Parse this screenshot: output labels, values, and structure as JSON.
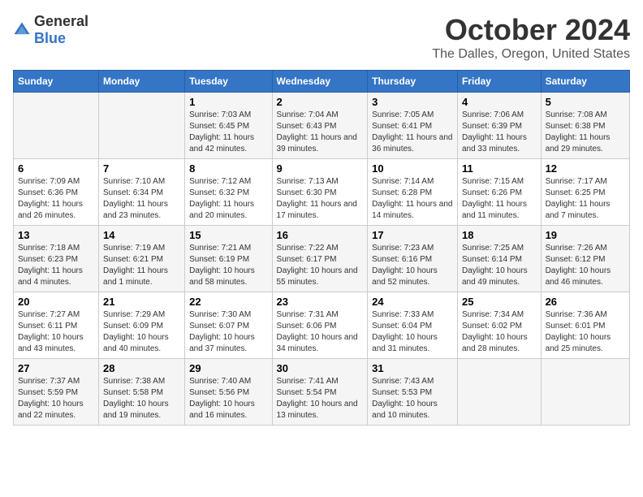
{
  "logo": {
    "general": "General",
    "blue": "Blue"
  },
  "header": {
    "title": "October 2024",
    "subtitle": "The Dalles, Oregon, United States"
  },
  "days_of_week": [
    "Sunday",
    "Monday",
    "Tuesday",
    "Wednesday",
    "Thursday",
    "Friday",
    "Saturday"
  ],
  "weeks": [
    [
      {
        "day": "",
        "sunrise": "",
        "sunset": "",
        "daylight": ""
      },
      {
        "day": "",
        "sunrise": "",
        "sunset": "",
        "daylight": ""
      },
      {
        "day": "1",
        "sunrise": "Sunrise: 7:03 AM",
        "sunset": "Sunset: 6:45 PM",
        "daylight": "Daylight: 11 hours and 42 minutes."
      },
      {
        "day": "2",
        "sunrise": "Sunrise: 7:04 AM",
        "sunset": "Sunset: 6:43 PM",
        "daylight": "Daylight: 11 hours and 39 minutes."
      },
      {
        "day": "3",
        "sunrise": "Sunrise: 7:05 AM",
        "sunset": "Sunset: 6:41 PM",
        "daylight": "Daylight: 11 hours and 36 minutes."
      },
      {
        "day": "4",
        "sunrise": "Sunrise: 7:06 AM",
        "sunset": "Sunset: 6:39 PM",
        "daylight": "Daylight: 11 hours and 33 minutes."
      },
      {
        "day": "5",
        "sunrise": "Sunrise: 7:08 AM",
        "sunset": "Sunset: 6:38 PM",
        "daylight": "Daylight: 11 hours and 29 minutes."
      }
    ],
    [
      {
        "day": "6",
        "sunrise": "Sunrise: 7:09 AM",
        "sunset": "Sunset: 6:36 PM",
        "daylight": "Daylight: 11 hours and 26 minutes."
      },
      {
        "day": "7",
        "sunrise": "Sunrise: 7:10 AM",
        "sunset": "Sunset: 6:34 PM",
        "daylight": "Daylight: 11 hours and 23 minutes."
      },
      {
        "day": "8",
        "sunrise": "Sunrise: 7:12 AM",
        "sunset": "Sunset: 6:32 PM",
        "daylight": "Daylight: 11 hours and 20 minutes."
      },
      {
        "day": "9",
        "sunrise": "Sunrise: 7:13 AM",
        "sunset": "Sunset: 6:30 PM",
        "daylight": "Daylight: 11 hours and 17 minutes."
      },
      {
        "day": "10",
        "sunrise": "Sunrise: 7:14 AM",
        "sunset": "Sunset: 6:28 PM",
        "daylight": "Daylight: 11 hours and 14 minutes."
      },
      {
        "day": "11",
        "sunrise": "Sunrise: 7:15 AM",
        "sunset": "Sunset: 6:26 PM",
        "daylight": "Daylight: 11 hours and 11 minutes."
      },
      {
        "day": "12",
        "sunrise": "Sunrise: 7:17 AM",
        "sunset": "Sunset: 6:25 PM",
        "daylight": "Daylight: 11 hours and 7 minutes."
      }
    ],
    [
      {
        "day": "13",
        "sunrise": "Sunrise: 7:18 AM",
        "sunset": "Sunset: 6:23 PM",
        "daylight": "Daylight: 11 hours and 4 minutes."
      },
      {
        "day": "14",
        "sunrise": "Sunrise: 7:19 AM",
        "sunset": "Sunset: 6:21 PM",
        "daylight": "Daylight: 11 hours and 1 minute."
      },
      {
        "day": "15",
        "sunrise": "Sunrise: 7:21 AM",
        "sunset": "Sunset: 6:19 PM",
        "daylight": "Daylight: 10 hours and 58 minutes."
      },
      {
        "day": "16",
        "sunrise": "Sunrise: 7:22 AM",
        "sunset": "Sunset: 6:17 PM",
        "daylight": "Daylight: 10 hours and 55 minutes."
      },
      {
        "day": "17",
        "sunrise": "Sunrise: 7:23 AM",
        "sunset": "Sunset: 6:16 PM",
        "daylight": "Daylight: 10 hours and 52 minutes."
      },
      {
        "day": "18",
        "sunrise": "Sunrise: 7:25 AM",
        "sunset": "Sunset: 6:14 PM",
        "daylight": "Daylight: 10 hours and 49 minutes."
      },
      {
        "day": "19",
        "sunrise": "Sunrise: 7:26 AM",
        "sunset": "Sunset: 6:12 PM",
        "daylight": "Daylight: 10 hours and 46 minutes."
      }
    ],
    [
      {
        "day": "20",
        "sunrise": "Sunrise: 7:27 AM",
        "sunset": "Sunset: 6:11 PM",
        "daylight": "Daylight: 10 hours and 43 minutes."
      },
      {
        "day": "21",
        "sunrise": "Sunrise: 7:29 AM",
        "sunset": "Sunset: 6:09 PM",
        "daylight": "Daylight: 10 hours and 40 minutes."
      },
      {
        "day": "22",
        "sunrise": "Sunrise: 7:30 AM",
        "sunset": "Sunset: 6:07 PM",
        "daylight": "Daylight: 10 hours and 37 minutes."
      },
      {
        "day": "23",
        "sunrise": "Sunrise: 7:31 AM",
        "sunset": "Sunset: 6:06 PM",
        "daylight": "Daylight: 10 hours and 34 minutes."
      },
      {
        "day": "24",
        "sunrise": "Sunrise: 7:33 AM",
        "sunset": "Sunset: 6:04 PM",
        "daylight": "Daylight: 10 hours and 31 minutes."
      },
      {
        "day": "25",
        "sunrise": "Sunrise: 7:34 AM",
        "sunset": "Sunset: 6:02 PM",
        "daylight": "Daylight: 10 hours and 28 minutes."
      },
      {
        "day": "26",
        "sunrise": "Sunrise: 7:36 AM",
        "sunset": "Sunset: 6:01 PM",
        "daylight": "Daylight: 10 hours and 25 minutes."
      }
    ],
    [
      {
        "day": "27",
        "sunrise": "Sunrise: 7:37 AM",
        "sunset": "Sunset: 5:59 PM",
        "daylight": "Daylight: 10 hours and 22 minutes."
      },
      {
        "day": "28",
        "sunrise": "Sunrise: 7:38 AM",
        "sunset": "Sunset: 5:58 PM",
        "daylight": "Daylight: 10 hours and 19 minutes."
      },
      {
        "day": "29",
        "sunrise": "Sunrise: 7:40 AM",
        "sunset": "Sunset: 5:56 PM",
        "daylight": "Daylight: 10 hours and 16 minutes."
      },
      {
        "day": "30",
        "sunrise": "Sunrise: 7:41 AM",
        "sunset": "Sunset: 5:54 PM",
        "daylight": "Daylight: 10 hours and 13 minutes."
      },
      {
        "day": "31",
        "sunrise": "Sunrise: 7:43 AM",
        "sunset": "Sunset: 5:53 PM",
        "daylight": "Daylight: 10 hours and 10 minutes."
      },
      {
        "day": "",
        "sunrise": "",
        "sunset": "",
        "daylight": ""
      },
      {
        "day": "",
        "sunrise": "",
        "sunset": "",
        "daylight": ""
      }
    ]
  ]
}
